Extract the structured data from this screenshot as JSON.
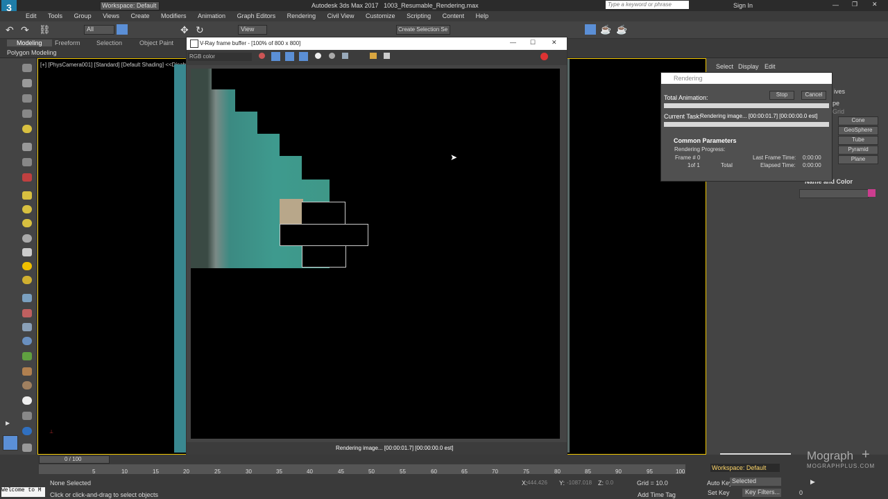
{
  "app": {
    "title": "Autodesk 3ds Max 2017",
    "file": "1003_Resumable_Rendering.max",
    "workspace": "Workspace: Default",
    "search_placeholder": "Type a keyword or phrase",
    "sign_in": "Sign In"
  },
  "menus": [
    "Edit",
    "Tools",
    "Group",
    "Views",
    "Create",
    "Modifiers",
    "Animation",
    "Graph Editors",
    "Rendering",
    "Civil View",
    "Customize",
    "Scripting",
    "Content",
    "Help"
  ],
  "toolbar": {
    "filter": "All",
    "view": "View",
    "selection_set": "Create Selection Se"
  },
  "ribbon": {
    "tabs": [
      "Modeling",
      "Freeform",
      "Selection",
      "Object Paint"
    ],
    "sub": "Polygon Modeling"
  },
  "viewport_label": "[+] [PhysCamera001] [Standard] [Default Shading]  <<Disab",
  "vfb": {
    "title": "V-Ray frame buffer - [100% of 800 x 800]",
    "channel": "RGB color",
    "status": "Rendering image... [00:00:01.7] [00:00:00.0 est]"
  },
  "render_dialog": {
    "title": "Rendering",
    "total_animation": "Total Animation:",
    "current_task_label": "Current Task:",
    "current_task": "Rendering image... [00:00:01.7] [00:00:00.0 est]",
    "stop": "Stop",
    "cancel": "Cancel",
    "section": "Common Parameters",
    "progress_label": "Rendering Progress:",
    "frame_label": "Frame #",
    "frame_value": "0",
    "of": "1of 1",
    "total": "Total",
    "last_frame_label": "Last Frame Time:",
    "last_frame_value": "0:00:00",
    "elapsed_label": "Elapsed Time:",
    "elapsed_value": "0:00:00"
  },
  "command_panel": {
    "tabs": [
      "Select",
      "Display",
      "Edit"
    ],
    "buttons": [
      "Cone",
      "GeoSphere",
      "Tube",
      "Pyramid",
      "Plane"
    ],
    "partial_labels": [
      "ives",
      "pe",
      "Grid"
    ],
    "section": "Name and Color",
    "color": "#cc3d8f"
  },
  "timeline": {
    "frame": "0 / 100",
    "ticks": [
      "5",
      "10",
      "15",
      "20",
      "25",
      "30",
      "35",
      "40",
      "45",
      "50",
      "55",
      "60",
      "65",
      "70",
      "75",
      "80",
      "85",
      "90",
      "95",
      "100"
    ]
  },
  "status": {
    "selection": "None Selected",
    "prompt": "Click or click-and-drag to select objects",
    "script": "Welcome to M",
    "x_label": "X:",
    "x_value": "444.426",
    "y_label": "Y:",
    "y_value": "-1087.018",
    "z_label": "Z:",
    "z_value": "0.0",
    "grid": "Grid = 10.0",
    "add_time_tag": "Add Time Tag",
    "auto_key": "Auto Key",
    "set_key": "Set Key",
    "selected": "Selected",
    "key_filters": "Key Filters...",
    "frame_field": "0",
    "workspace_corner": "Workspace: Default"
  },
  "watermark": {
    "brand": "Mograph",
    "site": "MOGRAPHPLUS.COM"
  }
}
